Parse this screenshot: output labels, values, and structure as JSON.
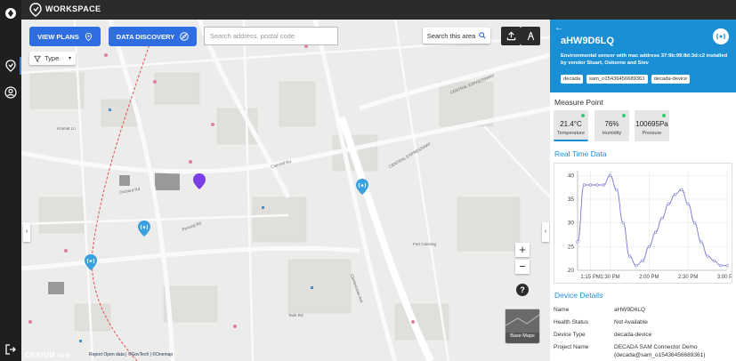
{
  "app": {
    "title": "WORKSPACE"
  },
  "toolbar": {
    "view_plans": "VIEW PLANS",
    "data_discovery": "DATA DISCOVERY",
    "search_placeholder": "Search address, postal code",
    "search_area": "Search this area",
    "filter_label": "Type"
  },
  "map": {
    "zoom_in": "+",
    "zoom_out": "−",
    "help": "?",
    "base_maps": "Base Maps",
    "cesium_logo": "CESIUM ion",
    "credits": "Report  Open data  |  ©GovTech  |  ©Onemap",
    "street_labels": [
      "CENTRAL EXPRESSWAY",
      "CENTRAL EXPRESSWAY",
      "Cairnhill Rd",
      "Orchard Rd",
      "Penang Rd",
      "Clemenceau Ave",
      "Kramat Ln",
      "Tank Rd",
      "Fort Canning"
    ]
  },
  "device": {
    "name": "aHW9D6LQ",
    "description": "Environmental sensor with mac address 37:9b:99:8d:3d:c2 installed by vendor Stuart, Osborne and Stev",
    "tags": [
      "decada",
      "sam_o15436456689361",
      "decada-device"
    ]
  },
  "measure_point": {
    "title": "Measure Point",
    "items": [
      {
        "value": "21.4°C",
        "label": "Temperature",
        "selected": true
      },
      {
        "value": "76%",
        "label": "Humidity",
        "selected": false
      },
      {
        "value": "100695Pa",
        "label": "Pressure",
        "selected": false
      }
    ]
  },
  "realtime": {
    "title": "Real Time Data"
  },
  "chart_data": {
    "type": "line",
    "x": [
      "1:05 PM",
      "1:10 PM",
      "1:15 PM",
      "1:20 PM",
      "1:25 PM",
      "1:30 PM",
      "1:35 PM",
      "1:40 PM",
      "1:45 PM",
      "1:50 PM",
      "1:55 PM",
      "2:00 PM",
      "2:05 PM",
      "2:10 PM",
      "2:15 PM",
      "2:20 PM",
      "2:25 PM",
      "2:30 PM",
      "2:35 PM",
      "2:40 PM",
      "2:45 PM",
      "2:50 PM",
      "2:55 PM",
      "3:00 PM"
    ],
    "values": [
      26,
      38,
      38,
      38,
      38,
      40,
      37,
      30,
      23,
      21,
      22,
      25,
      28,
      31,
      34,
      36,
      37,
      34,
      30,
      26,
      23,
      22,
      21,
      21
    ],
    "x_ticks": [
      "1:15 PM",
      "1:30 PM",
      "2:00 PM",
      "2:30 PM",
      "3:00 PM"
    ],
    "y_ticks": [
      20,
      25,
      30,
      35,
      40
    ],
    "ylim": [
      20,
      41
    ],
    "color": "#7b7bd6",
    "grid": true
  },
  "details": {
    "title": "Device Details",
    "rows": [
      {
        "key": "Name",
        "value": "aHW9D6LQ"
      },
      {
        "key": "Health Status",
        "value": "Not Available"
      },
      {
        "key": "Device Type",
        "value": "decada-device"
      },
      {
        "key": "Project Name",
        "value": "DECADA SAM Connector Demo (decada@sam_o15436456689361)"
      }
    ]
  },
  "colors": {
    "primary": "#2f6ee0",
    "panel_header": "#1b8fd6",
    "topbar": "#2b2b2b",
    "status_dot": "#2ecc71"
  }
}
